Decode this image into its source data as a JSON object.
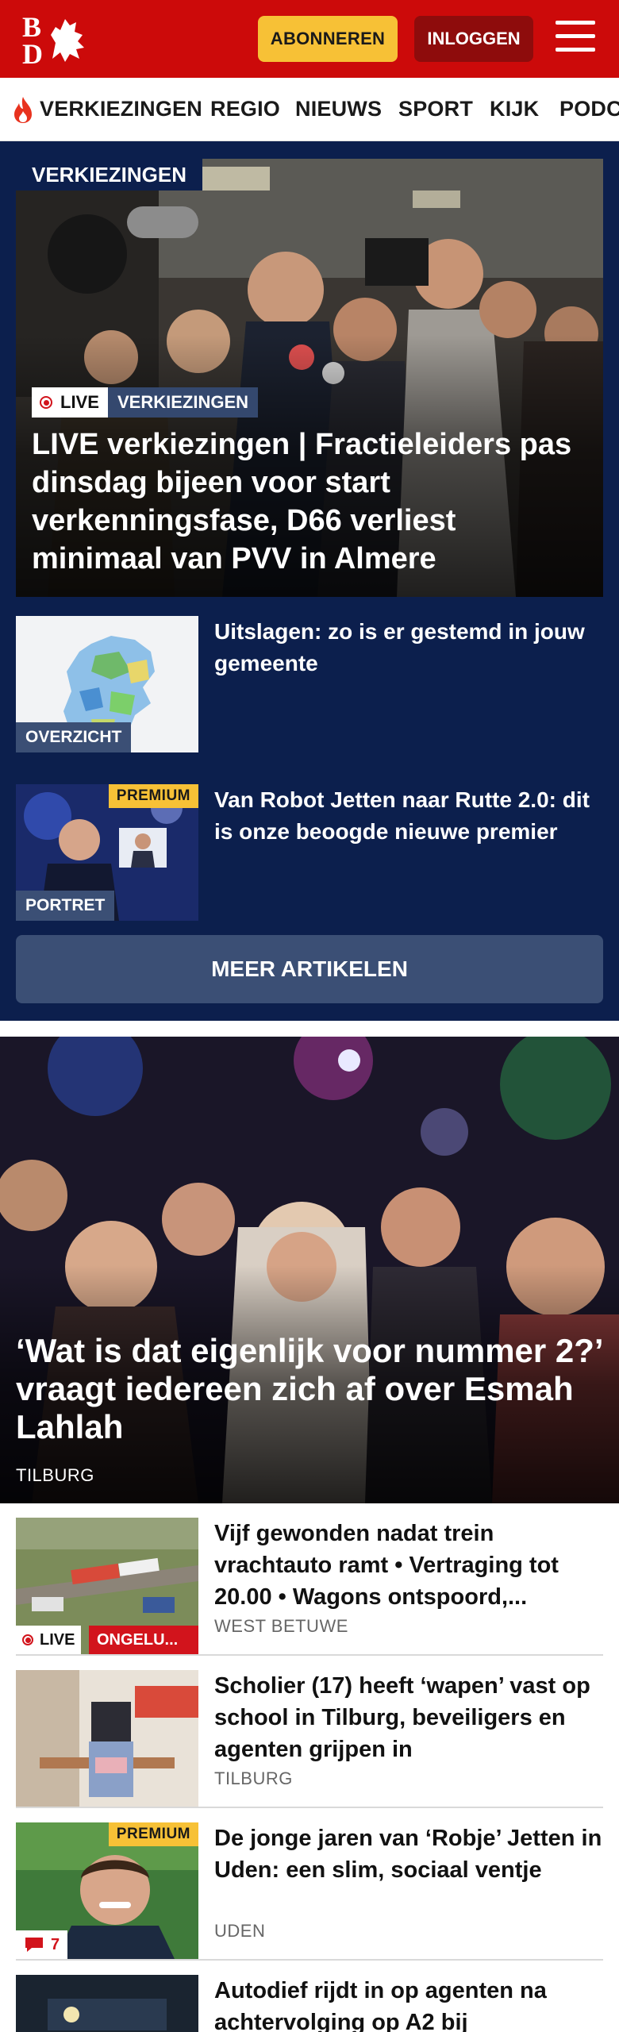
{
  "header": {
    "logo_text": "BD",
    "subscribe_label": "ABONNEREN",
    "login_label": "INLOGGEN"
  },
  "nav": {
    "items": [
      "VERKIEZINGEN",
      "REGIO",
      "NIEUWS",
      "SPORT",
      "KIJK",
      "PODC"
    ]
  },
  "elections": {
    "section_label": "VERKIEZINGEN",
    "hero": {
      "live_label": "LIVE",
      "category": "VERKIEZINGEN",
      "title": "LIVE verkiezingen | Fractieleiders pas dinsdag bijeen voor start verkenningsfase, D66 verliest minimaal van PVV in Almere"
    },
    "cards": [
      {
        "label": "OVERZICHT",
        "title": "Uitslagen: zo is er gestemd in jouw gemeente"
      },
      {
        "label": "PORTRET",
        "premium": "PREMIUM",
        "title": "Van Robot Jetten naar Rutte 2.0: dit is onze beoogde nieuwe premier"
      }
    ],
    "more_label": "MEER ARTIKELEN"
  },
  "hero2": {
    "title": "‘Wat is dat eigenlijk voor nummer 2?’ vraagt iedereen zich af over Esmah Lahlah",
    "location": "TILBURG"
  },
  "articles": [
    {
      "title": "Vijf gewonden nadat trein vrachtauto ramt • Vertraging tot 20.00 • Wagons ontspoord,...",
      "location": "WEST BETUWE",
      "live_label": "LIVE",
      "tag": "ONGELU..."
    },
    {
      "title": "Scholier (17) heeft ‘wapen’ vast op school in Tilburg, beveiligers en agenten grijpen in",
      "location": "TILBURG"
    },
    {
      "title": "De jonge jaren van ‘Robje’ Jetten in Uden: een slim, sociaal ventje",
      "location": "UDEN",
      "premium": "PREMIUM",
      "comments": "7"
    },
    {
      "title": "Autodief rijdt in op agenten na achtervolging op A2 bij"
    }
  ],
  "colors": {
    "brand_red": "#cc0a0a",
    "navy": "#0c1f4d",
    "premium_yellow": "#f7c136",
    "live_red": "#d2141c"
  }
}
